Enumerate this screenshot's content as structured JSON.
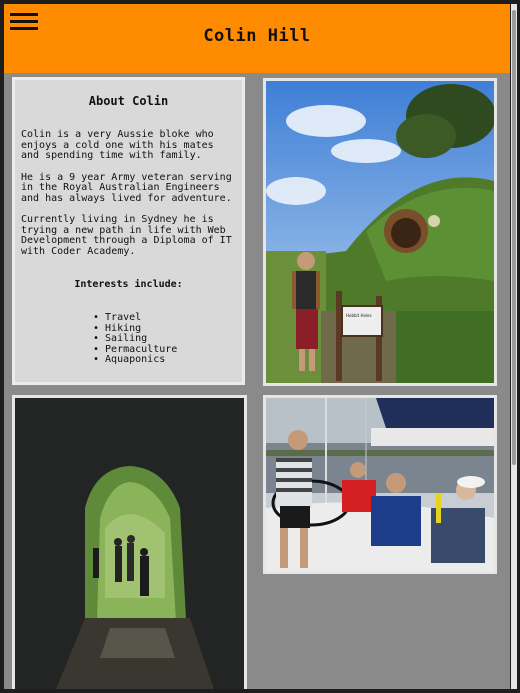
{
  "header": {
    "title": "Colin Hill",
    "menu_icon": "hamburger-menu-icon",
    "background": "#ff8c00"
  },
  "about": {
    "heading": "About Colin",
    "paragraphs": [
      "Colin is a very Aussie bloke who enjoys a cold one with his mates and spending time with family.",
      "He is a 9 year Army veteran serving in the Royal Australian Engineers and has always lived for adventure.",
      "Currently living in Sydney he is trying a new path in life with Web Development through a Diploma of IT with Coder Academy."
    ],
    "interests_heading": "Interests include:",
    "interests": [
      "Travel",
      "Hiking",
      "Sailing",
      "Permaculture",
      "Aquaponics"
    ]
  },
  "photos": {
    "hobbit_sign": "Hobbit Holes"
  }
}
